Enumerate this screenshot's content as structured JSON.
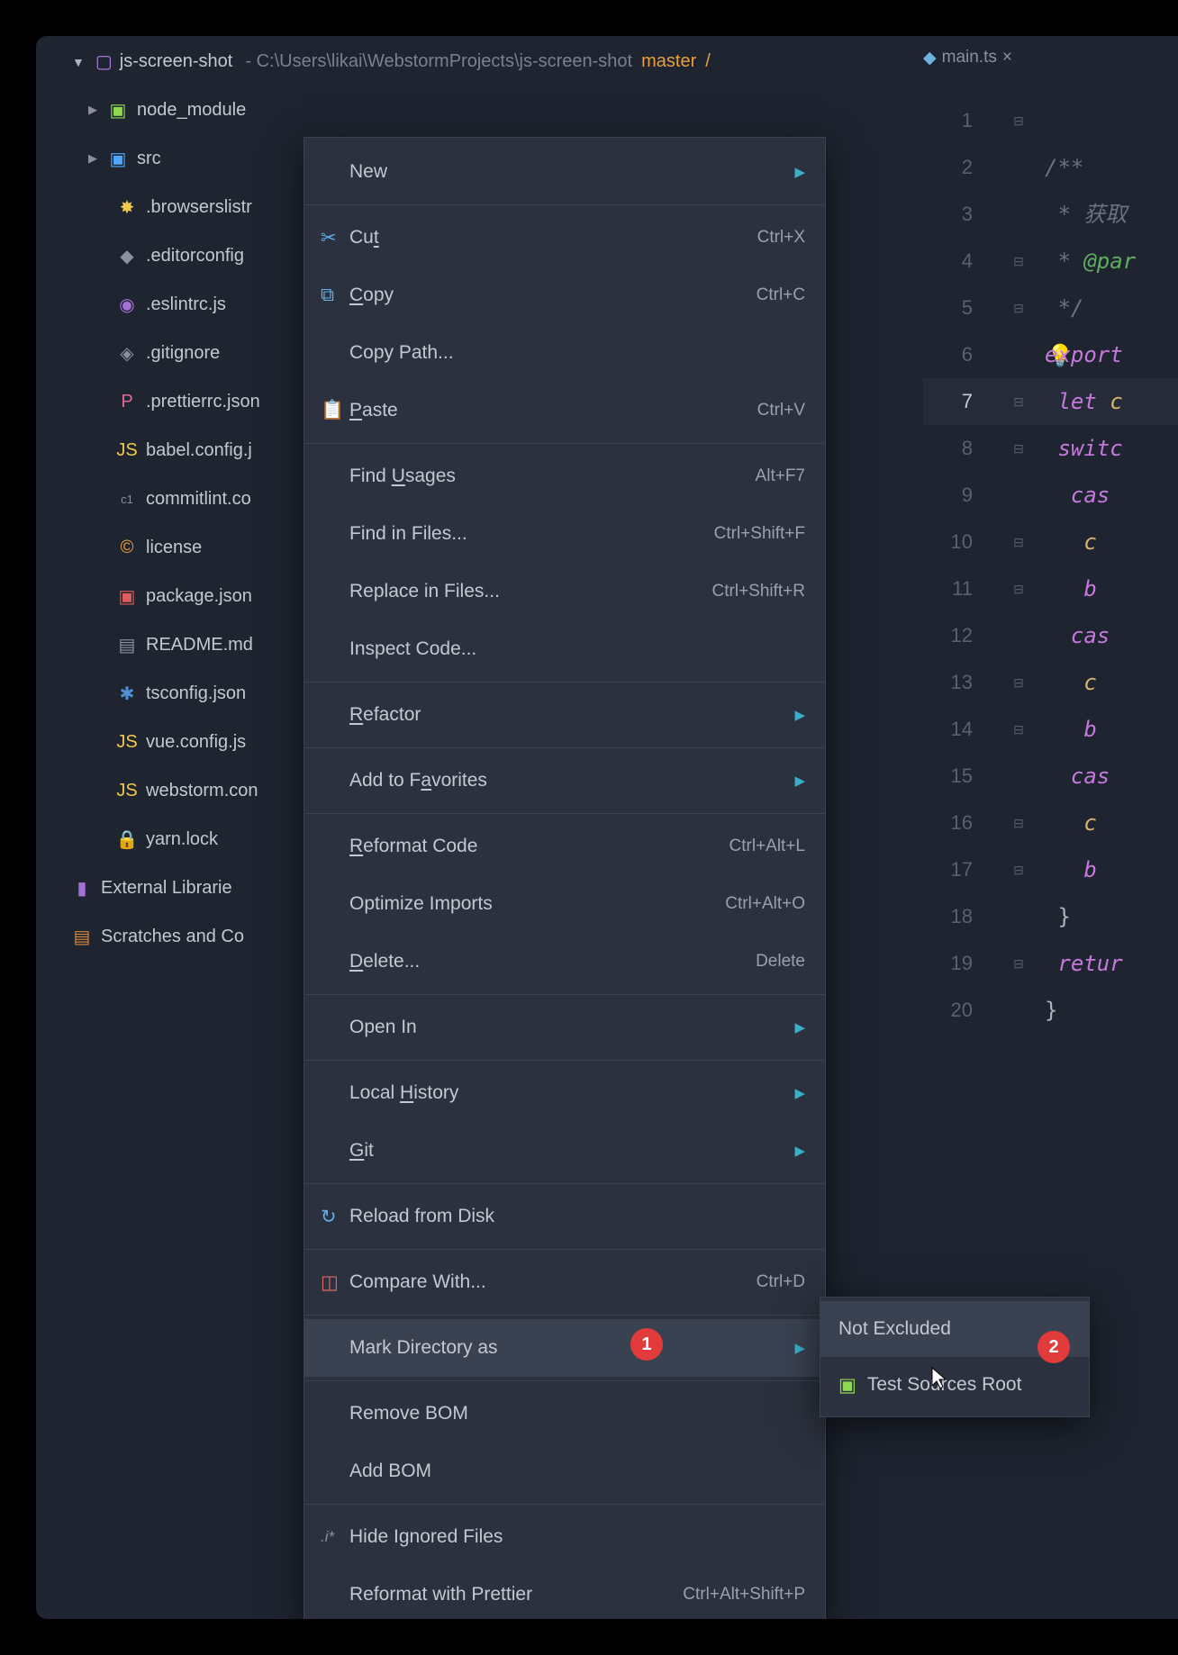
{
  "header": {
    "project": "js-screen-shot",
    "path": "- C:\\Users\\likai\\WebstormProjects\\js-screen-shot",
    "branch": "master",
    "sep": "/"
  },
  "tree": {
    "items": [
      {
        "label": "node_module",
        "expandable": true
      },
      {
        "label": "src",
        "expandable": true
      },
      {
        "label": ".browserslistr"
      },
      {
        "label": ".editorconfig"
      },
      {
        "label": ".eslintrc.js"
      },
      {
        "label": ".gitignore"
      },
      {
        "label": ".prettierrc.json"
      },
      {
        "label": "babel.config.j"
      },
      {
        "label": "commitlint.co"
      },
      {
        "label": "license"
      },
      {
        "label": "package.json"
      },
      {
        "label": "README.md"
      },
      {
        "label": "tsconfig.json"
      },
      {
        "label": "vue.config.js"
      },
      {
        "label": "webstorm.con"
      },
      {
        "label": "yarn.lock"
      }
    ],
    "external": "External Librarie",
    "scratches": "Scratches and Co"
  },
  "editor": {
    "tab_name": "main.ts",
    "lines": [
      "1",
      "2",
      "3",
      "4",
      "5",
      "6",
      "7",
      "8",
      "9",
      "10",
      "11",
      "12",
      "13",
      "14",
      "15",
      "16",
      "17",
      "18",
      "19",
      "20"
    ],
    "active_line": "7",
    "code": {
      "l1": "/**",
      "l2": " * 获取",
      "l3_pre": " * ",
      "l3_tag": "@par",
      "l4": " */",
      "l5": "export ",
      "l6_kw": "let",
      "l6_id": " c",
      "l7": "switc",
      "l8": "cas",
      "l9": "c",
      "l10": "b",
      "l11": "cas",
      "l12": "c",
      "l13": "b",
      "l14": "cas",
      "l15": "c",
      "l16": "b",
      "l17": "}",
      "l18": "retur",
      "l19": "}"
    }
  },
  "ctx": [
    {
      "type": "item",
      "label": "New",
      "arrow": true
    },
    {
      "type": "sep"
    },
    {
      "type": "item",
      "icon": "cut",
      "u": "t",
      "label_pre": "Cu",
      "label_post": "",
      "sc": "Ctrl+X"
    },
    {
      "type": "item",
      "icon": "copy",
      "u": "C",
      "label_pre": "",
      "label_post": "opy",
      "sc": "Ctrl+C"
    },
    {
      "type": "item",
      "label": "Copy Path..."
    },
    {
      "type": "item",
      "icon": "paste",
      "u": "P",
      "label_pre": "",
      "label_post": "aste",
      "sc": "Ctrl+V"
    },
    {
      "type": "sep"
    },
    {
      "type": "item",
      "u": "U",
      "label_pre": "Find ",
      "label_post": "sages",
      "sc": "Alt+F7"
    },
    {
      "type": "item",
      "label": "Find in Files...",
      "sc": "Ctrl+Shift+F"
    },
    {
      "type": "item",
      "label": "Replace in Files...",
      "sc": "Ctrl+Shift+R"
    },
    {
      "type": "item",
      "label": "Inspect Code..."
    },
    {
      "type": "sep"
    },
    {
      "type": "item",
      "u": "R",
      "label_pre": "",
      "label_post": "efactor",
      "arrow": true
    },
    {
      "type": "sep"
    },
    {
      "type": "item",
      "u": "a",
      "label_pre": "Add to F",
      "label_post": "vorites",
      "arrow": true
    },
    {
      "type": "sep"
    },
    {
      "type": "item",
      "u": "R",
      "label_pre": "",
      "label_post": "eformat Code",
      "sc": "Ctrl+Alt+L"
    },
    {
      "type": "item",
      "label": "Optimize Imports",
      "sc": "Ctrl+Alt+O"
    },
    {
      "type": "item",
      "u": "D",
      "label_pre": "",
      "label_post": "elete...",
      "sc": "Delete"
    },
    {
      "type": "sep"
    },
    {
      "type": "item",
      "label": "Open In",
      "arrow": true
    },
    {
      "type": "sep"
    },
    {
      "type": "item",
      "u": "H",
      "label_pre": "Local ",
      "label_post": "istory",
      "arrow": true
    },
    {
      "type": "item",
      "u": "G",
      "label_pre": "",
      "label_post": "it",
      "arrow": true
    },
    {
      "type": "sep"
    },
    {
      "type": "item",
      "icon": "reload",
      "label": "Reload from Disk"
    },
    {
      "type": "sep"
    },
    {
      "type": "item",
      "icon": "compare",
      "label": "Compare With...",
      "sc": "Ctrl+D"
    },
    {
      "type": "sep"
    },
    {
      "type": "item",
      "label": "Mark Directory as",
      "arrow": true,
      "highlight": true
    },
    {
      "type": "sep"
    },
    {
      "type": "item",
      "label": "Remove BOM"
    },
    {
      "type": "item",
      "label": "Add BOM"
    },
    {
      "type": "sep"
    },
    {
      "type": "item",
      "icon": "hide",
      "label": "Hide Ignored Files"
    },
    {
      "type": "item",
      "label": "Reformat with Prettier",
      "sc": "Ctrl+Alt+Shift+P"
    }
  ],
  "submenu": {
    "not_excluded": "Not Excluded",
    "test_sources": "Test Sources Root"
  },
  "badges": {
    "one": "1",
    "two": "2"
  }
}
